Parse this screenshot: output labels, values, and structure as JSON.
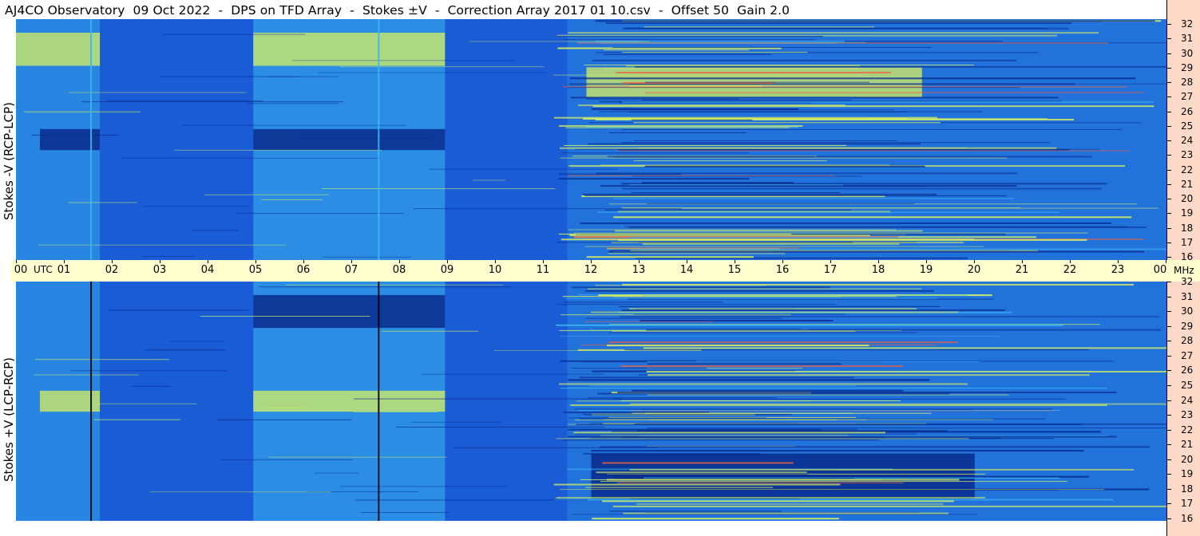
{
  "title": "AJ4CO Observatory  09 Oct 2022  -  DPS on TFD Array  -  Stokes ±V  -  Correction Array 2017 01 10.csv  -  Offset 50  Gain 2.0",
  "colors": {
    "base_blue": "#1a5bd6",
    "deep_blue": "#082a8c",
    "cyan": "#3ab8f0",
    "yellow_green": "#d8f060",
    "orange_red": "#f0603a",
    "axis_bg": "#ffffd0",
    "freq_bg": "#ffd9c8"
  },
  "chart_data": [
    {
      "type": "heatmap",
      "panel": "top",
      "ylabel": "Stokes -V (RCP-LCP)",
      "x_unit": "UTC",
      "y_unit": "MHz",
      "xlim": [
        0,
        24
      ],
      "ylim": [
        16,
        32
      ],
      "yticks": [
        "16",
        "17",
        "18",
        "19",
        "20",
        "21",
        "22",
        "23",
        "24",
        "25",
        "26",
        "27",
        "28",
        "29",
        "30",
        "31",
        "32"
      ],
      "features": [
        {
          "x": [
            0.5,
            1.75
          ],
          "y": [
            23.3,
            24.7
          ],
          "level": "low"
        },
        {
          "x": [
            4.95,
            8.95
          ],
          "y": [
            23.3,
            24.7
          ],
          "level": "low"
        },
        {
          "x": [
            4.95,
            8.95
          ],
          "y": [
            28.9,
            31.1
          ],
          "level": "high"
        },
        {
          "x": [
            0,
            1.75
          ],
          "y": [
            28.9,
            31.1
          ],
          "level": "high"
        },
        {
          "x": [
            11.9,
            18.9
          ],
          "y": [
            26.8,
            28.8
          ],
          "level": "high"
        }
      ]
    },
    {
      "type": "heatmap",
      "panel": "bottom",
      "ylabel": "Stokes +V (LCP-RCP)",
      "x_unit": "UTC",
      "y_unit": "MHz",
      "xlim": [
        0,
        24
      ],
      "ylim": [
        16,
        32
      ],
      "yticks": [
        "16",
        "17",
        "18",
        "19",
        "20",
        "21",
        "22",
        "23",
        "24",
        "25",
        "26",
        "27",
        "28",
        "29",
        "30",
        "31",
        "32"
      ],
      "features": [
        {
          "x": [
            0.5,
            1.75
          ],
          "y": [
            23.3,
            24.7
          ],
          "level": "high"
        },
        {
          "x": [
            4.95,
            8.95
          ],
          "y": [
            23.3,
            24.7
          ],
          "level": "high"
        },
        {
          "x": [
            4.95,
            8.95
          ],
          "y": [
            28.9,
            31.1
          ],
          "level": "low"
        },
        {
          "x": [
            12,
            20
          ],
          "y": [
            17.5,
            20.5
          ],
          "level": "low"
        }
      ]
    }
  ],
  "time_axis": {
    "labels": [
      "00",
      "01",
      "02",
      "03",
      "04",
      "05",
      "06",
      "07",
      "08",
      "09",
      "10",
      "11",
      "12",
      "13",
      "14",
      "15",
      "16",
      "17",
      "18",
      "19",
      "20",
      "21",
      "22",
      "23",
      "00"
    ],
    "unit_label": "UTC",
    "freq_unit_label": "MHz"
  }
}
